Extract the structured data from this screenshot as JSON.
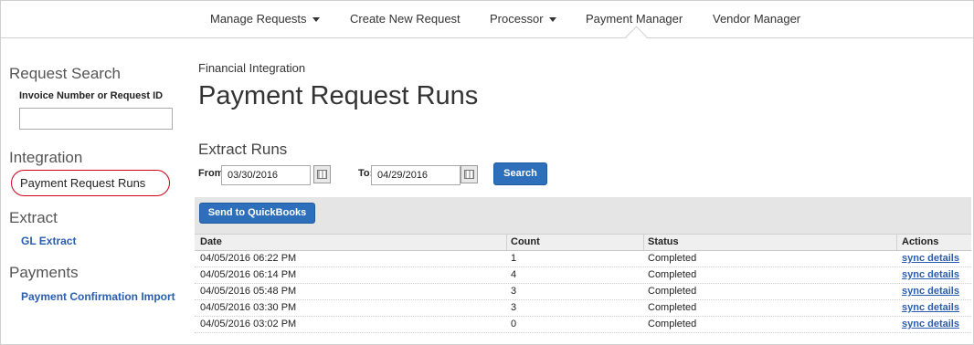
{
  "topnav": {
    "items": [
      {
        "label": "Manage Requests"
      },
      {
        "label": "Create New Request"
      },
      {
        "label": "Processor"
      },
      {
        "label": "Payment Manager"
      },
      {
        "label": "Vendor Manager"
      }
    ]
  },
  "sidebar": {
    "request_search": {
      "heading": "Request Search",
      "field_label": "Invoice Number or Request ID",
      "field_value": ""
    },
    "integration": {
      "heading": "Integration",
      "active_item": "Payment Request Runs"
    },
    "extract": {
      "heading": "Extract",
      "link": "GL Extract"
    },
    "payments": {
      "heading": "Payments",
      "link": "Payment Confirmation Import"
    }
  },
  "main": {
    "subtitle": "Financial Integration",
    "title": "Payment Request Runs",
    "section_title": "Extract Runs",
    "from_label": "From:",
    "from_value": "03/30/2016",
    "to_label": "To:",
    "to_value": "04/29/2016",
    "search_button": "Search",
    "send_button": "Send to QuickBooks"
  },
  "table": {
    "headers": {
      "date": "Date",
      "count": "Count",
      "status": "Status",
      "actions": "Actions"
    },
    "rows": [
      {
        "date": "04/05/2016 06:22 PM",
        "count": "1",
        "status": "Completed",
        "action": "sync details"
      },
      {
        "date": "04/05/2016 06:14 PM",
        "count": "4",
        "status": "Completed",
        "action": "sync details"
      },
      {
        "date": "04/05/2016 05:48 PM",
        "count": "3",
        "status": "Completed",
        "action": "sync details"
      },
      {
        "date": "04/05/2016 03:30 PM",
        "count": "3",
        "status": "Completed",
        "action": "sync details"
      },
      {
        "date": "04/05/2016 03:02 PM",
        "count": "0",
        "status": "Completed",
        "action": "sync details"
      }
    ]
  }
}
